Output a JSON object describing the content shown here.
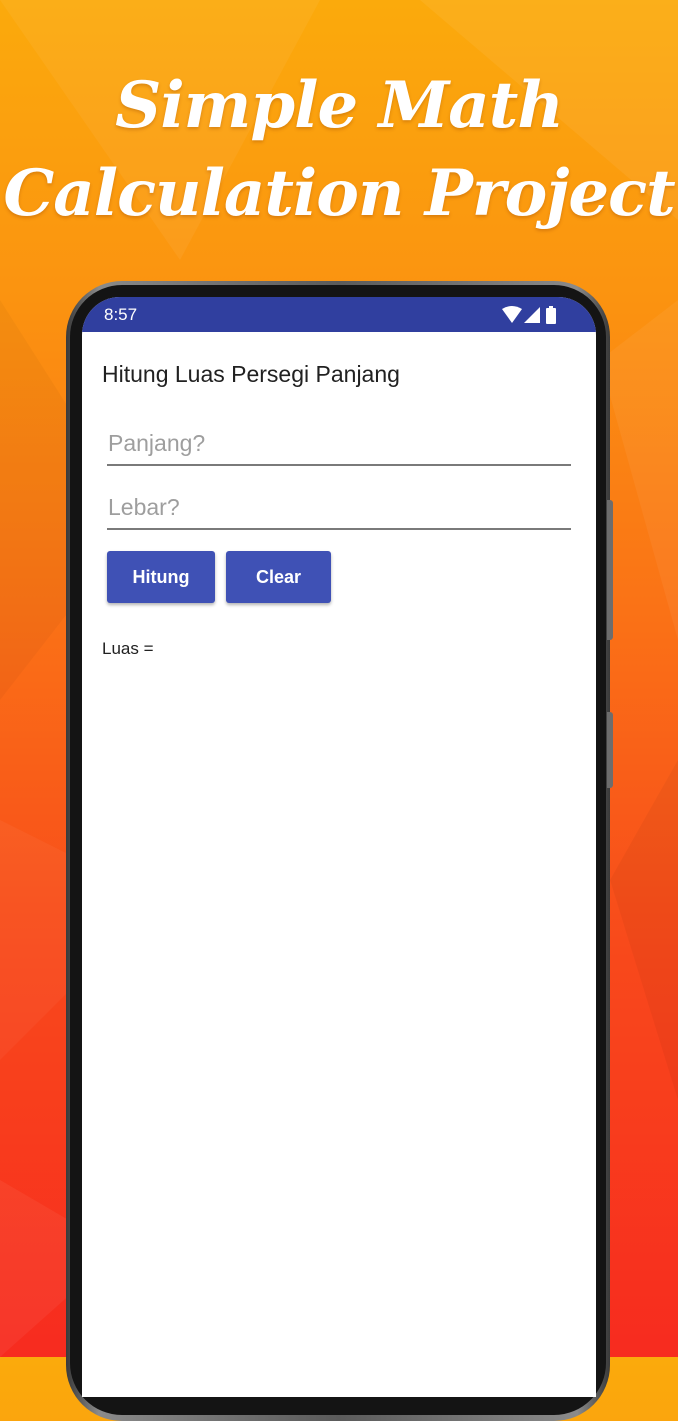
{
  "promo": {
    "headline_line1": "Simple Math",
    "headline_line2": "Calculation Project",
    "background_colors": [
      "#fbaa0c",
      "#fa7216",
      "#f72b1f"
    ]
  },
  "status_bar": {
    "time": "8:57",
    "icons": [
      "wifi-icon",
      "signal-icon",
      "battery-icon"
    ],
    "color": "#303f9f"
  },
  "app": {
    "title": "Hitung Luas Persegi Panjang",
    "panjang_input": {
      "value": "",
      "placeholder": "Panjang?"
    },
    "lebar_input": {
      "value": "",
      "placeholder": "Lebar?"
    },
    "hitung_label": "Hitung",
    "clear_label": "Clear",
    "result_label": "Luas =",
    "result_value": "",
    "accent": "#3f51b5"
  }
}
